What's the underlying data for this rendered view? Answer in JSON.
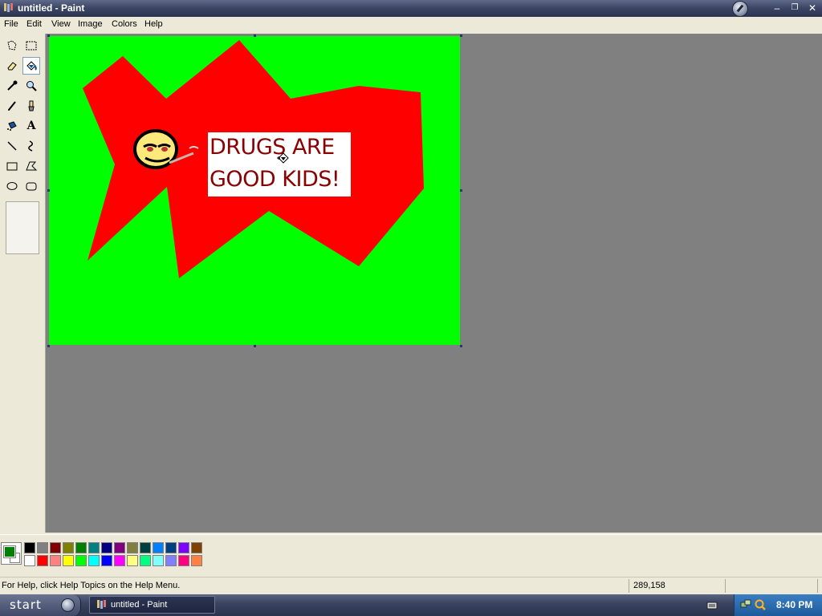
{
  "window": {
    "title": "untitled - Paint"
  },
  "menu": [
    "File",
    "Edit",
    "View",
    "Image",
    "Colors",
    "Help"
  ],
  "tools": [
    {
      "name": "free-form-select-icon"
    },
    {
      "name": "select-icon"
    },
    {
      "name": "eraser-icon"
    },
    {
      "name": "fill-with-color-icon",
      "active": true
    },
    {
      "name": "pick-color-icon"
    },
    {
      "name": "magnifier-icon"
    },
    {
      "name": "pencil-icon"
    },
    {
      "name": "brush-icon"
    },
    {
      "name": "airbrush-icon"
    },
    {
      "name": "text-icon"
    },
    {
      "name": "line-icon"
    },
    {
      "name": "curve-icon"
    },
    {
      "name": "rectangle-icon"
    },
    {
      "name": "polygon-icon"
    },
    {
      "name": "ellipse-icon"
    },
    {
      "name": "rounded-rectangle-icon"
    }
  ],
  "text_tool_glyph": "A",
  "canvas": {
    "background": "#00ff00",
    "shape_color": "#ff0000",
    "speech_lines": [
      "DRUGS ARE",
      "GOOD KIDS!"
    ],
    "speech_color": "#8b0000"
  },
  "palette": {
    "foreground": "#008000",
    "background": "#ffffff",
    "row1": [
      "#000000",
      "#808080",
      "#800000",
      "#808000",
      "#008000",
      "#008080",
      "#000080",
      "#800080",
      "#808040",
      "#004040",
      "#0080ff",
      "#004080",
      "#8000ff",
      "#804000"
    ],
    "row2": [
      "#ffffff",
      "#ff0000",
      "#ff8080",
      "#ffff00",
      "#00ff00",
      "#00ffff",
      "#0000ff",
      "#ff00ff",
      "#ffff80",
      "#00ff80",
      "#80ffff",
      "#8080ff",
      "#ff0080",
      "#ff8040"
    ]
  },
  "status": {
    "help": "For Help, click Help Topics on the Help Menu.",
    "coords": "289,158"
  },
  "taskbar": {
    "start_label": "start",
    "task_label": "untitled - Paint",
    "clock": "8:40 PM"
  }
}
